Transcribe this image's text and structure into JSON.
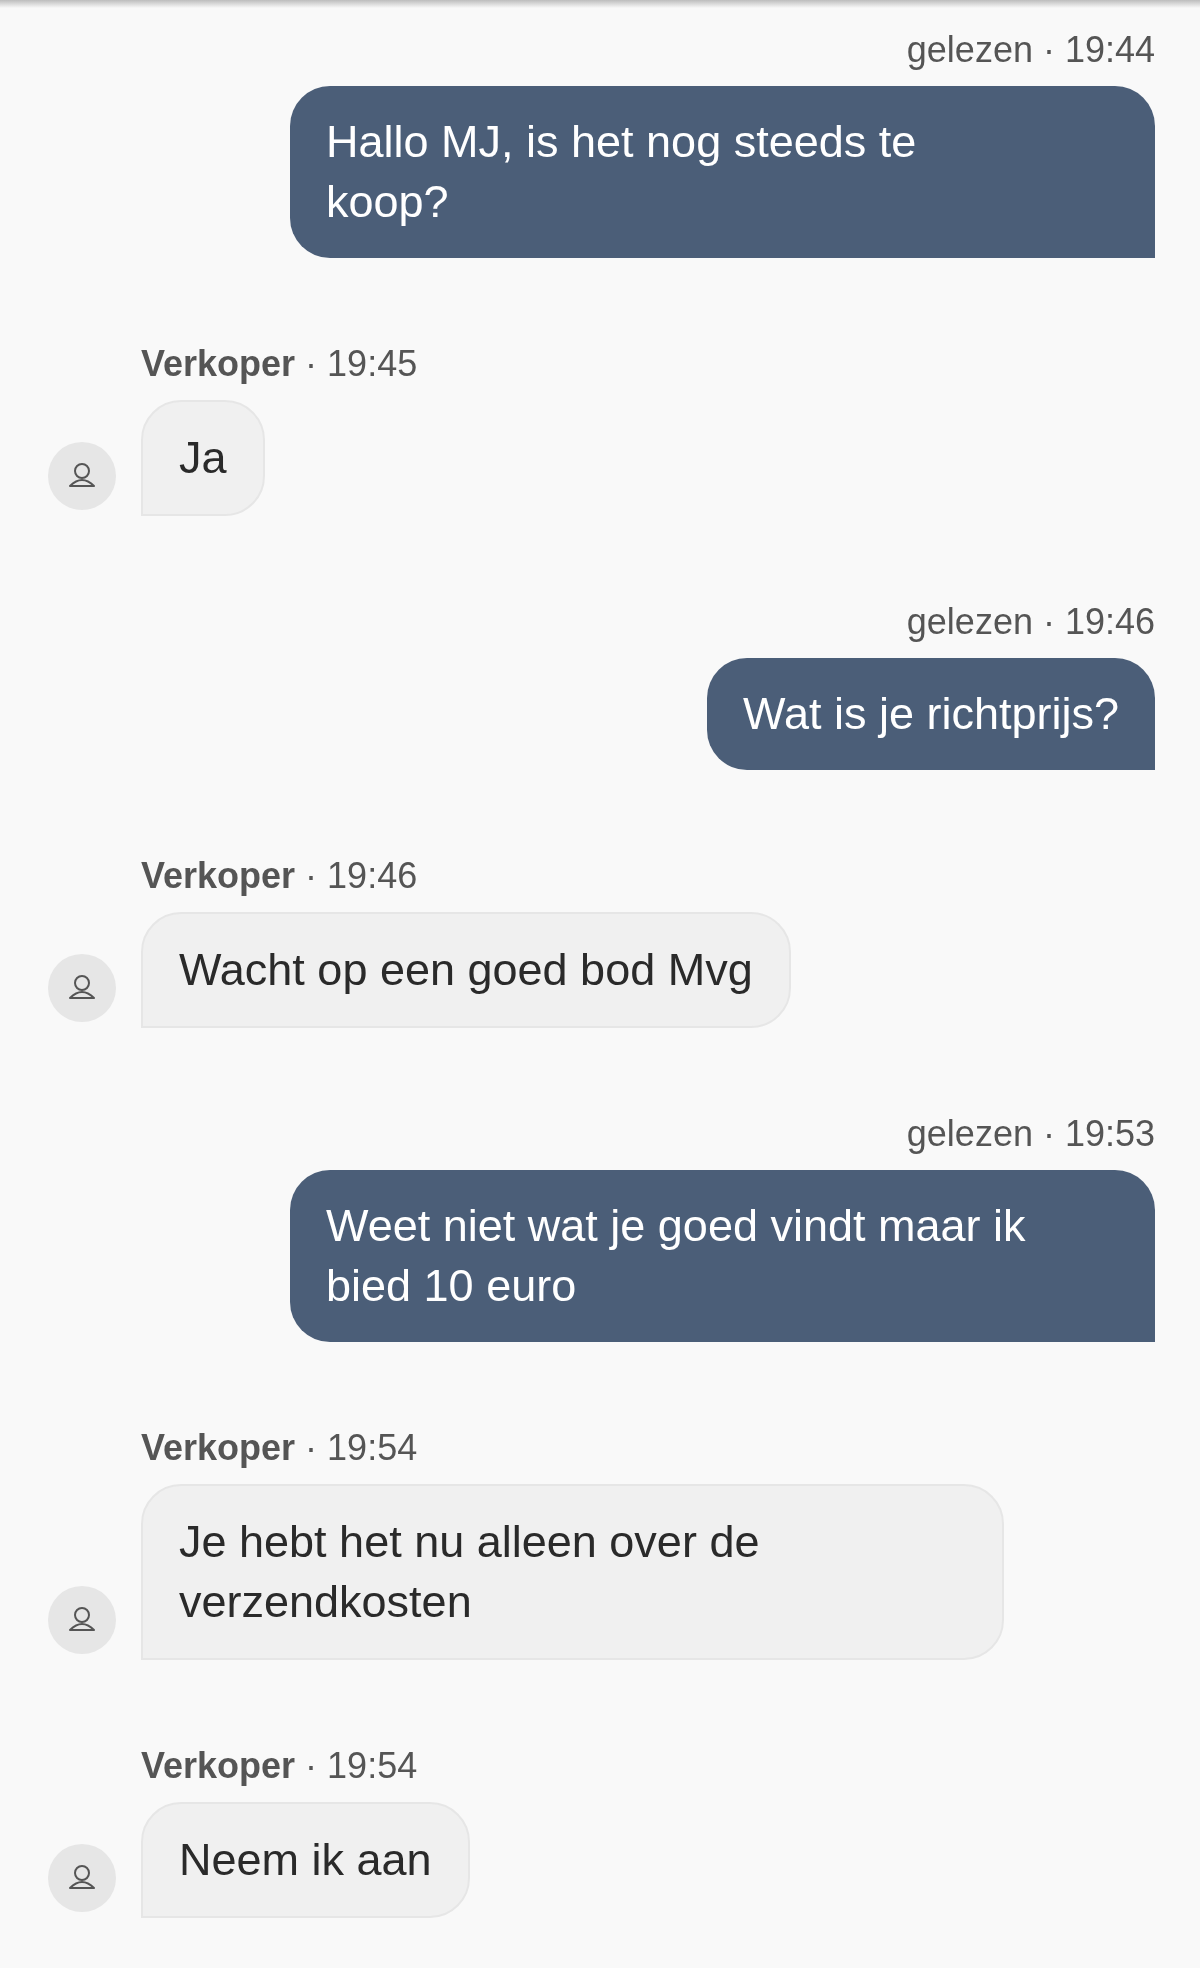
{
  "messages": [
    {
      "kind": "outgoing",
      "meta": "gelezen · 19:44",
      "text": "Hallo MJ, is het nog steeds te\nkoop?"
    },
    {
      "kind": "incoming",
      "meta": "**Verkoper** · 19:45",
      "text": "Ja"
    },
    {
      "kind": "outgoing",
      "meta": "gelezen · 19:46",
      "text": "Wat is je richtprijs?"
    },
    {
      "kind": "incoming",
      "meta": "**Verkoper** · 19:46",
      "text": "Wacht op een goed bod Mvg"
    },
    {
      "kind": "outgoing",
      "meta": "gelezen · 19:53",
      "text": "Weet niet wat je goed vindt maar ik\nbied 10 euro"
    },
    {
      "kind": "incoming",
      "meta": "**Verkoper** · 19:54",
      "text": "Je hebt het nu alleen over de\nverzendkosten",
      "wide": true
    },
    {
      "kind": "incoming",
      "meta": "**Verkoper** · 19:54",
      "text": "Neem ik aan"
    }
  ]
}
